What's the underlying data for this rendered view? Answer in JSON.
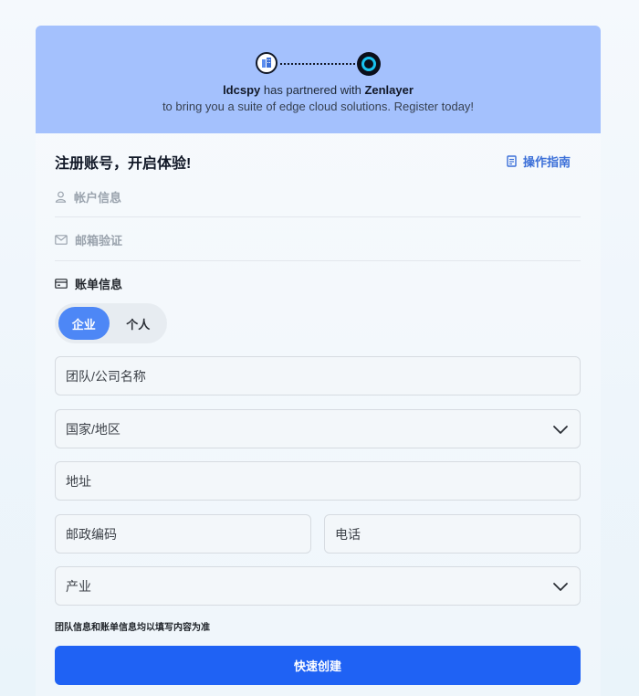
{
  "banner": {
    "partner_name": "ldcspy",
    "partner_mid": " has partnered with ",
    "provider_name": "Zenlayer",
    "subtitle": "to bring you a suite of edge cloud solutions. Register today!"
  },
  "header": {
    "title": "注册账号，开启体验!",
    "guide_label": "操作指南"
  },
  "steps": [
    {
      "label": "帐户信息",
      "icon": "user-icon"
    },
    {
      "label": "邮箱验证",
      "icon": "mail-icon"
    },
    {
      "label": "账单信息",
      "icon": "card-icon"
    }
  ],
  "account_type": {
    "options": [
      "企业",
      "个人"
    ],
    "selected": "企业"
  },
  "form": {
    "company_placeholder": "团队/公司名称",
    "country_placeholder": "国家/地区",
    "address_placeholder": "地址",
    "postal_placeholder": "邮政编码",
    "phone_placeholder": "电话",
    "industry_placeholder": "产业"
  },
  "note": "团队信息和账单信息均以填写内容为准",
  "submit_label": "快速创建",
  "colors": {
    "banner": "#a4c1fd",
    "accent": "#1f62f4",
    "toggle_active": "#4d87f6",
    "guide": "#3b6fd8"
  }
}
